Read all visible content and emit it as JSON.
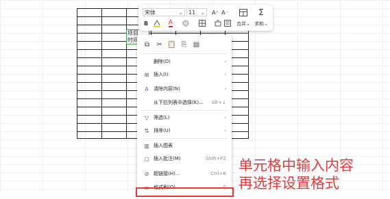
{
  "sheet": {
    "cell_text_line1": "项目",
    "cell_text_line2": "时间"
  },
  "toolbar": {
    "font_name": "宋体",
    "font_size": "11",
    "increase_font": "A⁺",
    "decrease_font": "A⁻",
    "bold": "B",
    "merge_label": "合并",
    "sum_label": "求和",
    "chevron": "⌄"
  },
  "menu": {
    "items": [
      {
        "icon": "",
        "label": "删除(D)",
        "right": "›"
      },
      {
        "icon": "⊞",
        "label": "插入(I)",
        "right": "›"
      },
      {
        "icon": "A",
        "label": "清除内容(N)",
        "right": "›"
      },
      {
        "icon": "",
        "label": "从下拉列表中选择(K)...",
        "right": "Alt+↓"
      },
      {
        "icon": "▽",
        "label": "筛选(L)",
        "right": "›"
      },
      {
        "icon": "⇅",
        "label": "排序(U)",
        "right": "›"
      },
      {
        "icon": "▥",
        "label": "插入图表",
        "right": ""
      },
      {
        "icon": "▢",
        "label": "插入批注(M)",
        "right": "Shift+F2"
      },
      {
        "icon": "⊘",
        "label": "超链接(H)...",
        "right": "Ctrl+K"
      },
      {
        "icon": "▭",
        "label": "格式刷(O)",
        "right": "⚲"
      }
    ]
  },
  "annotation": {
    "line1": "单元格中输入内容",
    "line2": "再选择设置格式"
  }
}
